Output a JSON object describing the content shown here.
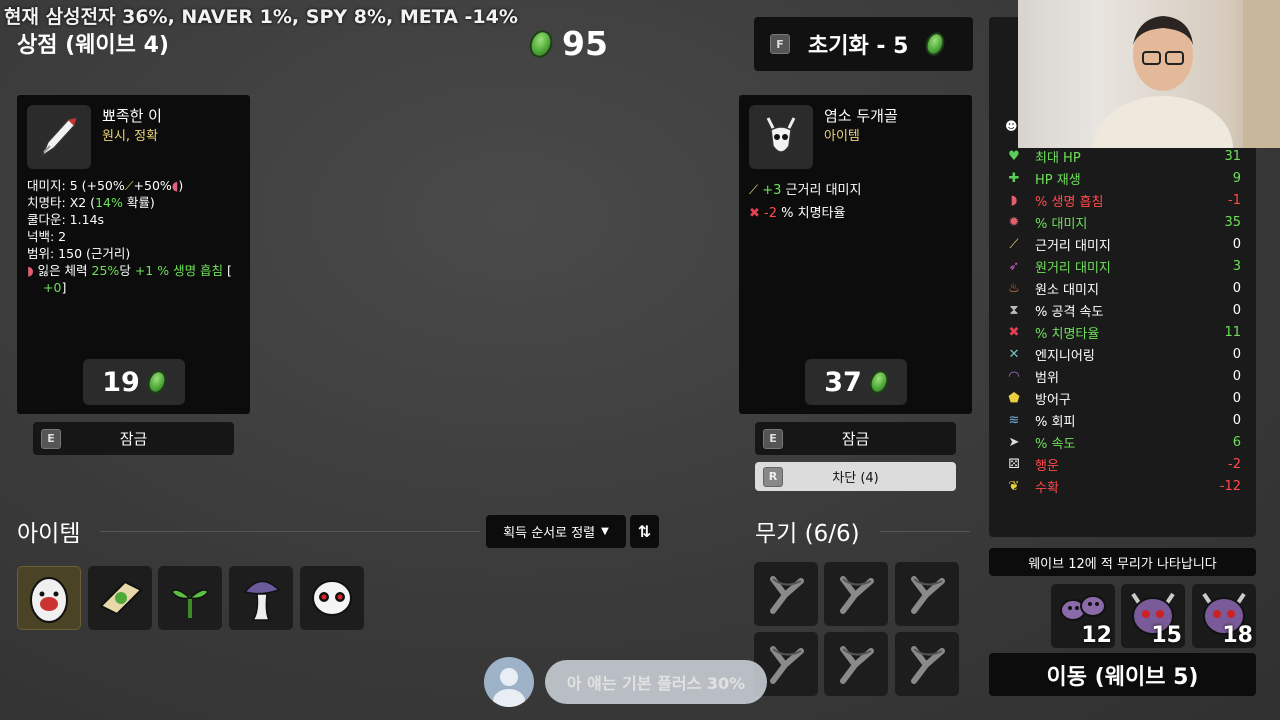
{
  "ticker": "현재 삼성전자 36%, NAVER 1%, SPY 8%, META -14%",
  "shop_title": "상점 (웨이브 4)",
  "gold": "95",
  "reroll": {
    "key": "F",
    "label": "초기화 - 5"
  },
  "card1": {
    "name": "뾰족한 이",
    "sub": "원시, 정확",
    "stats": {
      "damage_label": "대미지: ",
      "damage_value": "5 (+50%",
      "damage_rest": "+50%",
      "damage_end": ")",
      "crit_label": "치명타: ",
      "crit_value": "X2 (",
      "crit_pct": "14%",
      "crit_end": " 확률)",
      "cooldown": "쿨다운: 1.14s",
      "knockback": "넉백: 2",
      "range": "범위: 150 (근거리)",
      "effect_pre": "잃은 체력 ",
      "effect_pct": "25%",
      "effect_mid": "당 ",
      "effect_gain": "+1 % 생명 흡침",
      "effect_end": " [",
      "effect_cur": "+0",
      "effect_close": "]"
    },
    "price": "19",
    "lock": {
      "key": "E",
      "label": "잠금"
    }
  },
  "card2": {
    "name": "염소 두개골",
    "sub": "아이템",
    "line1_val": "+3",
    "line1_txt": " 근거리 대미지",
    "line2_val": "-2",
    "line2_txt": " % 치명타율",
    "price": "37",
    "lock": {
      "key": "E",
      "label": "잠금"
    },
    "ban": {
      "key": "R",
      "label": "차단 (4)"
    }
  },
  "items_title": "아이템",
  "sort_label": "획득 순서로 정렬",
  "sort_swap": "⇅",
  "weapons_title": "무기 (6/6)",
  "stats": [
    {
      "icon": "heart-icon",
      "name": "최대 HP",
      "value": "31",
      "color": "#6de05a"
    },
    {
      "icon": "hp-regen-icon",
      "name": "HP 재생",
      "value": "9",
      "color": "#6de05a"
    },
    {
      "icon": "lifesteal-icon",
      "name": "% 생명 흡침",
      "value": "-1",
      "color": "#ff4a4a"
    },
    {
      "icon": "damage-icon",
      "name": "% 대미지",
      "value": "35",
      "color": "#6de05a"
    },
    {
      "icon": "melee-icon",
      "name": "근거리 대미지",
      "value": "0",
      "color": "#ffffff"
    },
    {
      "icon": "ranged-icon",
      "name": "원거리 대미지",
      "value": "3",
      "color": "#6de05a"
    },
    {
      "icon": "elemental-icon",
      "name": "원소 대미지",
      "value": "0",
      "color": "#ffffff"
    },
    {
      "icon": "attack-speed-icon",
      "name": "% 공격 속도",
      "value": "0",
      "color": "#ffffff"
    },
    {
      "icon": "crit-icon",
      "name": "% 치명타율",
      "value": "11",
      "color": "#6de05a"
    },
    {
      "icon": "engineering-icon",
      "name": "엔지니어링",
      "value": "0",
      "color": "#ffffff"
    },
    {
      "icon": "range-icon",
      "name": "범위",
      "value": "0",
      "color": "#ffffff"
    },
    {
      "icon": "armor-icon",
      "name": "방어구",
      "value": "0",
      "color": "#ffffff"
    },
    {
      "icon": "dodge-icon",
      "name": "% 회피",
      "value": "0",
      "color": "#ffffff"
    },
    {
      "icon": "speed-icon",
      "name": "% 속도",
      "value": "6",
      "color": "#6de05a"
    },
    {
      "icon": "luck-icon",
      "name": "행운",
      "value": "-2",
      "color": "#ff4a4a"
    },
    {
      "icon": "harvest-icon",
      "name": "수확",
      "value": "-12",
      "color": "#ff4a4a"
    }
  ],
  "wave_msg": "웨이브 12에 적 무리가 나타납니다",
  "enemies": [
    "12",
    "15",
    "18"
  ],
  "move_button": "이동 (웨이브 5)",
  "chat_msg": "아 얘는 기본 플러스 30%",
  "colors": {
    "green": "#6de05a",
    "red": "#ff4a4a",
    "gold_text": "#e9d27a"
  }
}
